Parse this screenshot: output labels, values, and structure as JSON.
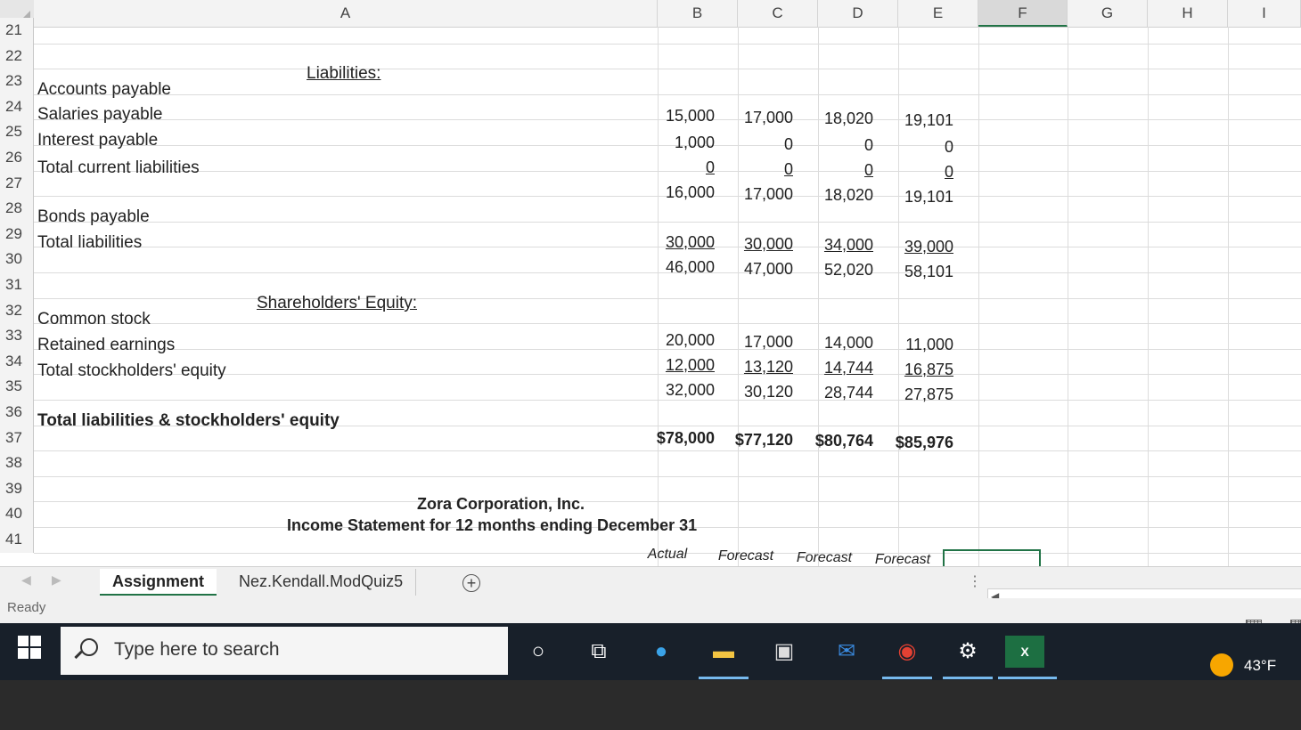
{
  "columns": [
    "A",
    "B",
    "C",
    "D",
    "E",
    "F",
    "G",
    "H",
    "I"
  ],
  "row_numbers": [
    "21",
    "22",
    "23",
    "24",
    "25",
    "26",
    "27",
    "28",
    "29",
    "30",
    "31",
    "32",
    "33",
    "34",
    "35",
    "36",
    "37",
    "38",
    "39",
    "40",
    "41"
  ],
  "balance_sheet": {
    "liabilities_header": "Liabilities:",
    "equity_header": "Shareholders' Equity:",
    "rows": [
      {
        "label": "Accounts payable",
        "values": [
          "",
          "",
          "",
          ""
        ]
      },
      {
        "label": "Salaries payable",
        "values": [
          "15,000",
          "17,000",
          "18,020",
          "19,101"
        ]
      },
      {
        "label": "Interest payable",
        "values": [
          "1,000",
          "0",
          "0",
          "0"
        ]
      },
      {
        "label": "Total current liabilities",
        "values": [
          "0",
          "0",
          "0",
          "0"
        ]
      },
      {
        "label": "",
        "values": [
          "16,000",
          "17,000",
          "18,020",
          "19,101"
        ]
      },
      {
        "label": "Bonds payable",
        "values": [
          "",
          "",
          "",
          ""
        ]
      },
      {
        "label": "Total liabilities",
        "values": [
          "30,000",
          "30,000",
          "34,000",
          "39,000"
        ]
      },
      {
        "label": "",
        "values": [
          "46,000",
          "47,000",
          "52,020",
          "58,101"
        ]
      },
      {
        "label": "Common stock",
        "values": [
          "",
          "",
          "",
          ""
        ]
      },
      {
        "label": "Retained earnings",
        "values": [
          "20,000",
          "17,000",
          "14,000",
          "11,000"
        ]
      },
      {
        "label": "Total stockholders' equity",
        "values": [
          "12,000",
          "13,120",
          "14,744",
          "16,875"
        ]
      },
      {
        "label": "",
        "values": [
          "32,000",
          "30,120",
          "28,744",
          "27,875"
        ]
      },
      {
        "label": "Total liabilities & stockholders' equity",
        "values": [
          "$78,000",
          "$77,120",
          "$80,764",
          "$85,976"
        ]
      }
    ]
  },
  "income_statement": {
    "company": "Zora Corporation, Inc.",
    "title": "Income Statement for 12 months ending December 31",
    "col_headers": [
      "Actual",
      "Forecast",
      "Forecast",
      "Forecast"
    ]
  },
  "sheet_tabs": [
    "Assignment",
    "Nez.Kendall.ModQuiz5"
  ],
  "active_tab": "Assignment",
  "status": "Ready",
  "taskbar": {
    "search_placeholder": "Type here to search",
    "temperature": "43°F",
    "excel_label": "X"
  }
}
